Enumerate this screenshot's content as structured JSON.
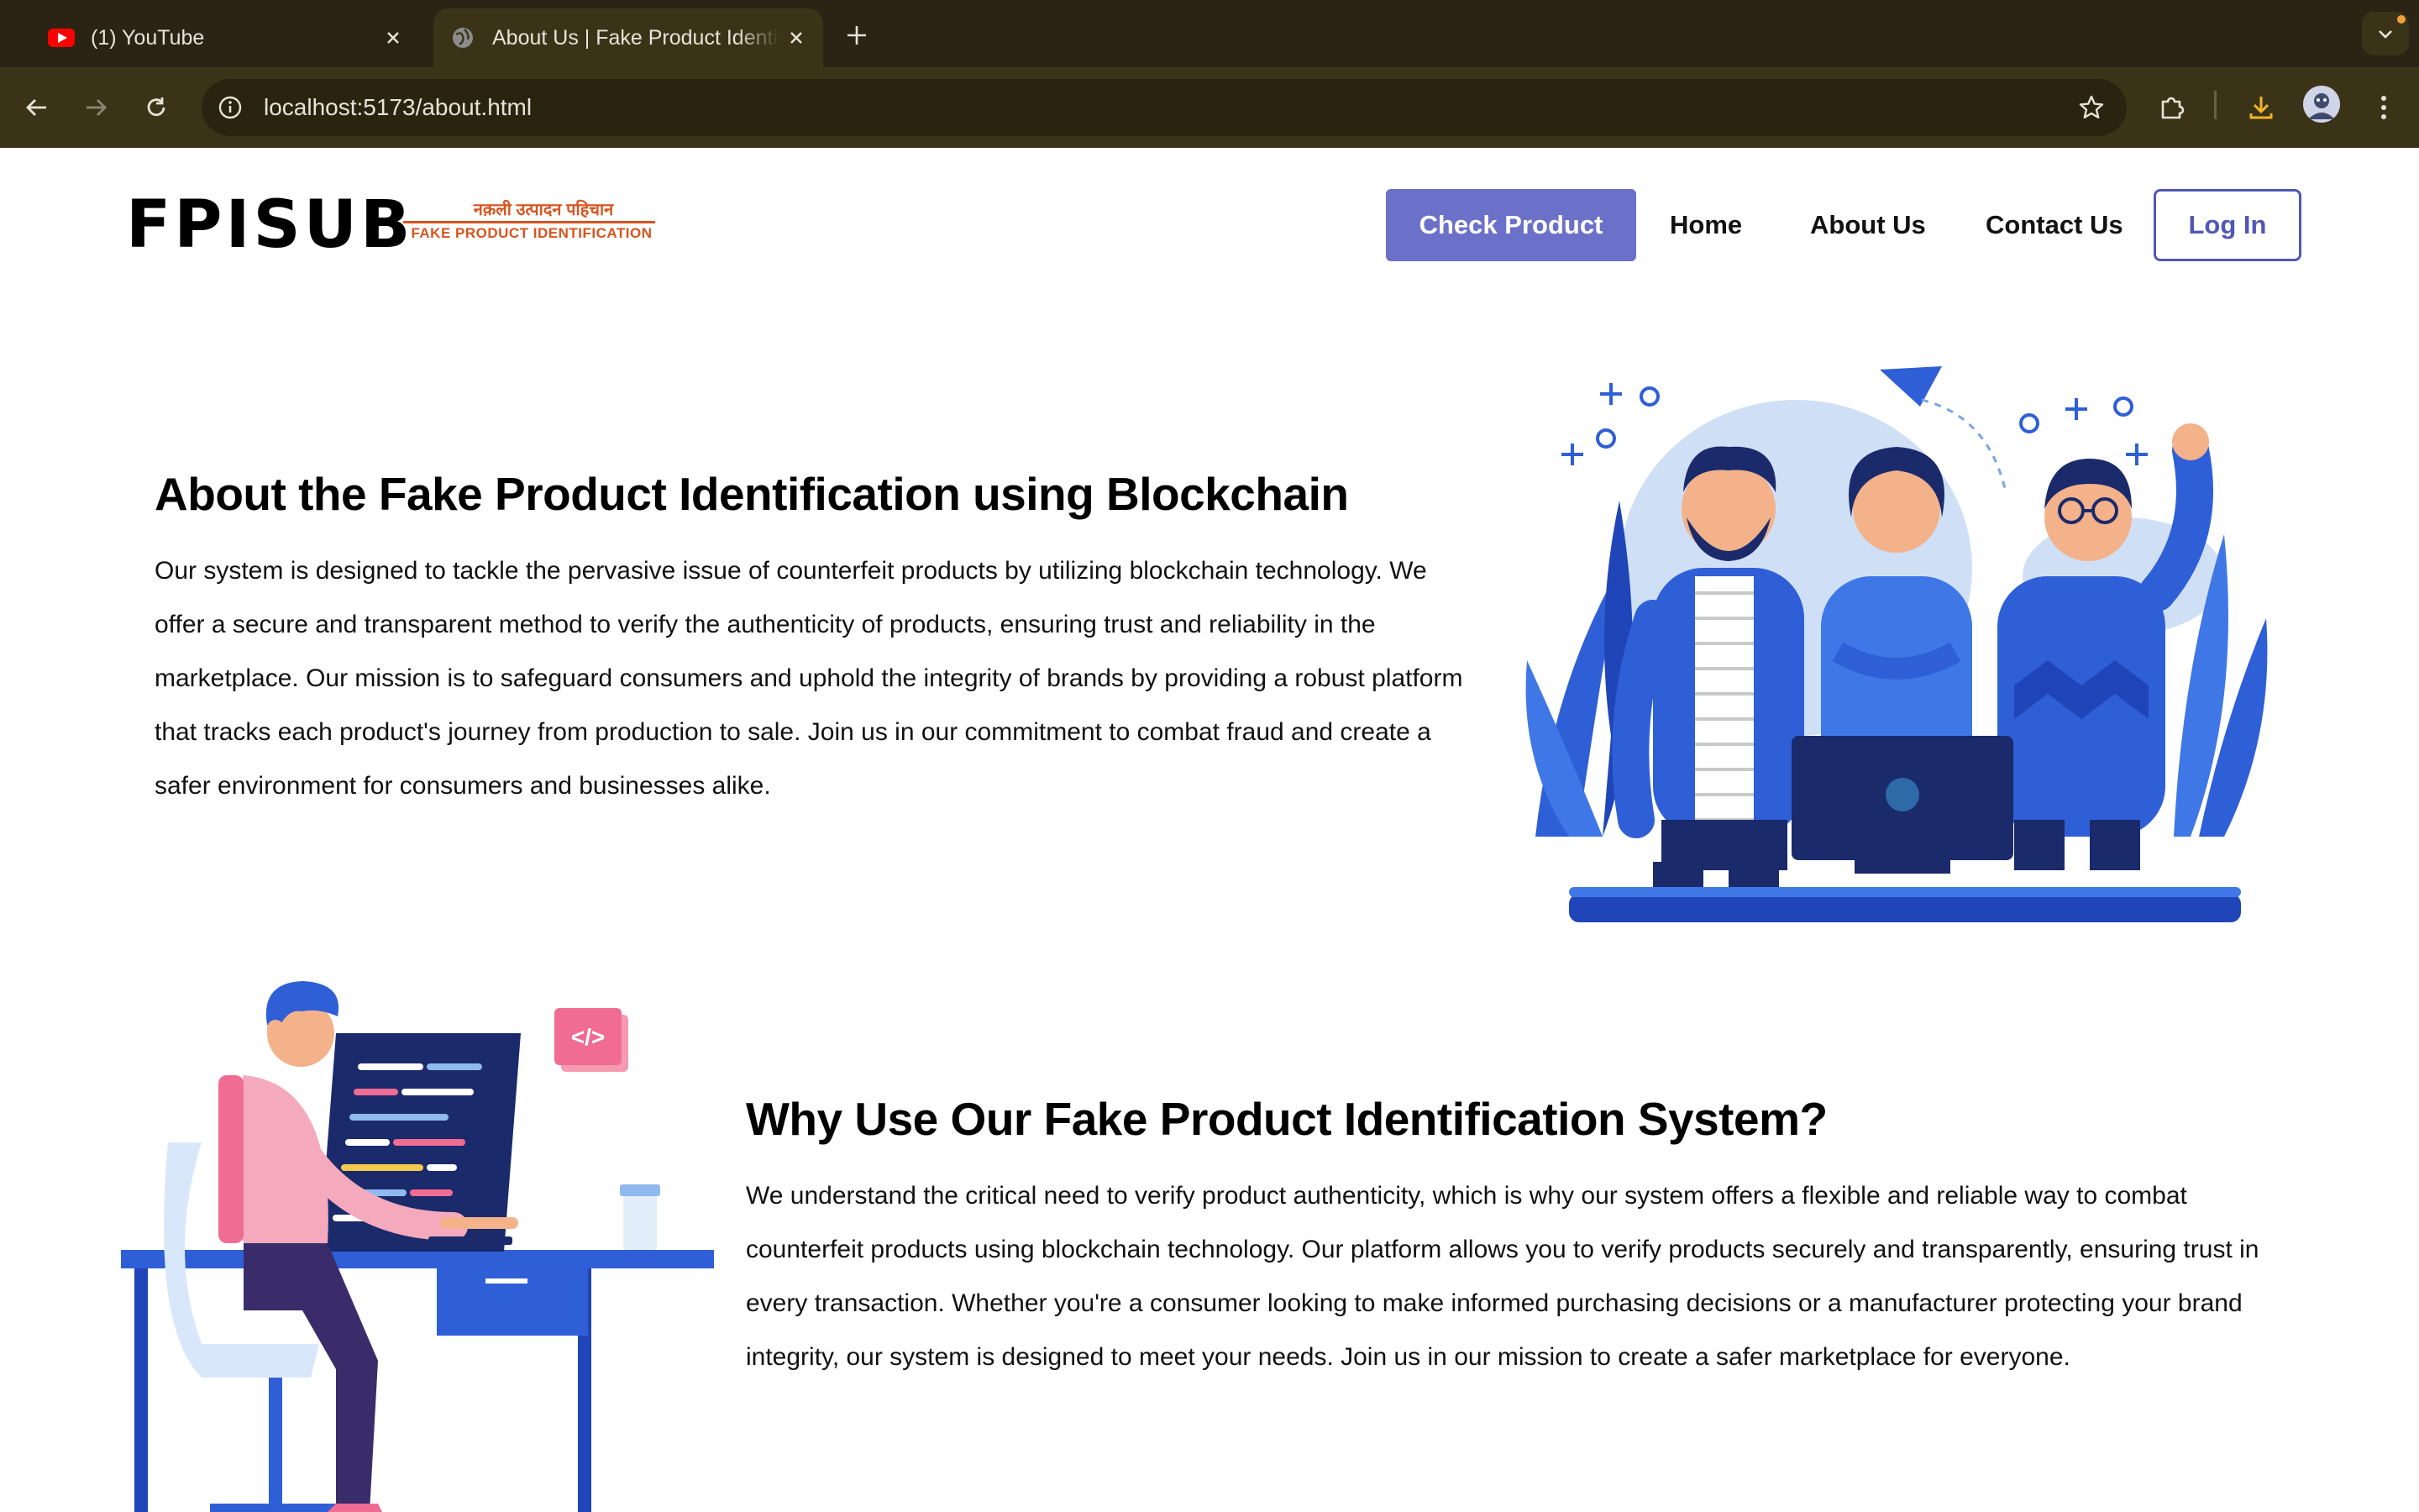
{
  "browser": {
    "tabs": [
      {
        "title": "(1) YouTube",
        "favicon": "youtube-icon",
        "active": false
      },
      {
        "title": "About Us | Fake Product Identification",
        "favicon": "globe-icon",
        "active": true
      }
    ],
    "url": "localhost:5173/about.html"
  },
  "site": {
    "logo": {
      "wordmark": "FPISUB",
      "hindi_tagline": "नक़ली उत्पादन पहिचान",
      "english_tagline": "FAKE PRODUCT IDENTIFICATION"
    },
    "nav": {
      "check_product": "Check Product",
      "home": "Home",
      "about": "About Us",
      "contact": "Contact Us",
      "login": "Log In"
    }
  },
  "sections": {
    "about": {
      "heading": "About the Fake Product Identification using Blockchain",
      "body": "Our system is designed to tackle the pervasive issue of counterfeit products by utilizing blockchain technology. We offer a secure and transparent method to verify the authenticity of products, ensuring trust and reliability in the marketplace. Our mission is to safeguard consumers and uphold the integrity of brands by providing a robust platform that tracks each product's journey from production to sale. Join us in our commitment to combat fraud and create a safer environment for consumers and businesses alike.",
      "image": "team-illustration"
    },
    "why": {
      "heading": "Why Use Our Fake Product Identification System?",
      "body": "We understand the critical need to verify product authenticity, which is why our system offers a flexible and reliable way to combat counterfeit products using blockchain technology. Our platform allows you to verify products securely and transparently, ensuring trust in every transaction. Whether you're a consumer looking to make informed purchasing decisions or a manufacturer protecting your brand integrity, our system is designed to meet your needs. Join us in our mission to create a safer marketplace for everyone.",
      "image": "developer-illustration",
      "code_badge": "</>"
    }
  },
  "colors": {
    "brand_primary": "#6b70c9",
    "brand_outline": "#5157b6",
    "logo_accent": "#d9531e",
    "illustration_blue": "#2f5fd6",
    "illustration_navy": "#1a2a6b",
    "illustration_pink": "#f06c93"
  }
}
